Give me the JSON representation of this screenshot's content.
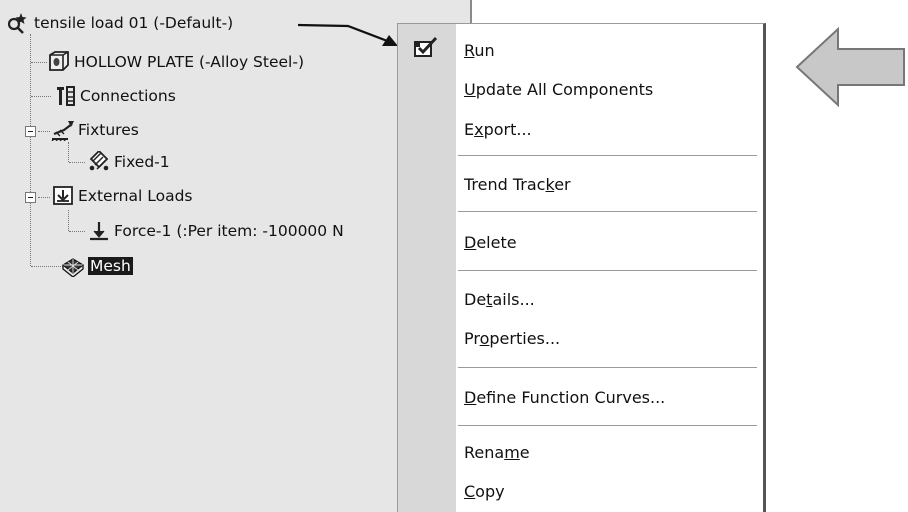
{
  "tree": {
    "root_label": "tensile load 01 (-Default-)",
    "items": [
      {
        "label": "HOLLOW PLATE (-Alloy Steel-)",
        "icon": "part-icon"
      },
      {
        "label": "Connections",
        "icon": "connections-icon"
      },
      {
        "label": "Fixtures",
        "icon": "fixtures-icon"
      },
      {
        "label": "Fixed-1",
        "icon": "fixed-geometry-icon"
      },
      {
        "label": "External Loads",
        "icon": "external-loads-icon"
      },
      {
        "label": "Force-1 (:Per item: -100000 N",
        "icon": "force-arrow-icon"
      },
      {
        "label": "Mesh",
        "icon": "mesh-icon",
        "selected": true
      }
    ]
  },
  "context_menu": {
    "items": [
      {
        "label": "Run",
        "mnemonic": "R"
      },
      {
        "label": "Update All Components",
        "mnemonic": "U"
      },
      {
        "label": "Export...",
        "mnemonic": "x"
      },
      {
        "label": "Trend Tracker",
        "mnemonic": "k"
      },
      {
        "label": "Delete",
        "mnemonic": "D"
      },
      {
        "label": "Details...",
        "mnemonic": "t"
      },
      {
        "label": "Properties...",
        "mnemonic": "o"
      },
      {
        "label": "Define Function Curves...",
        "mnemonic": "D"
      },
      {
        "label": "Rename",
        "mnemonic": "m"
      },
      {
        "label": "Copy",
        "mnemonic": "C"
      }
    ]
  },
  "annotations": {
    "pointer_arrow": "black-callout-arrow",
    "block_arrow": "gray-left-block-arrow"
  },
  "colors": {
    "panel_bg": "#e6e6e6",
    "menu_gutter": "#d8d8d8",
    "selection_bg": "#1a1a1a",
    "block_arrow_fill": "#c8c8c8"
  }
}
